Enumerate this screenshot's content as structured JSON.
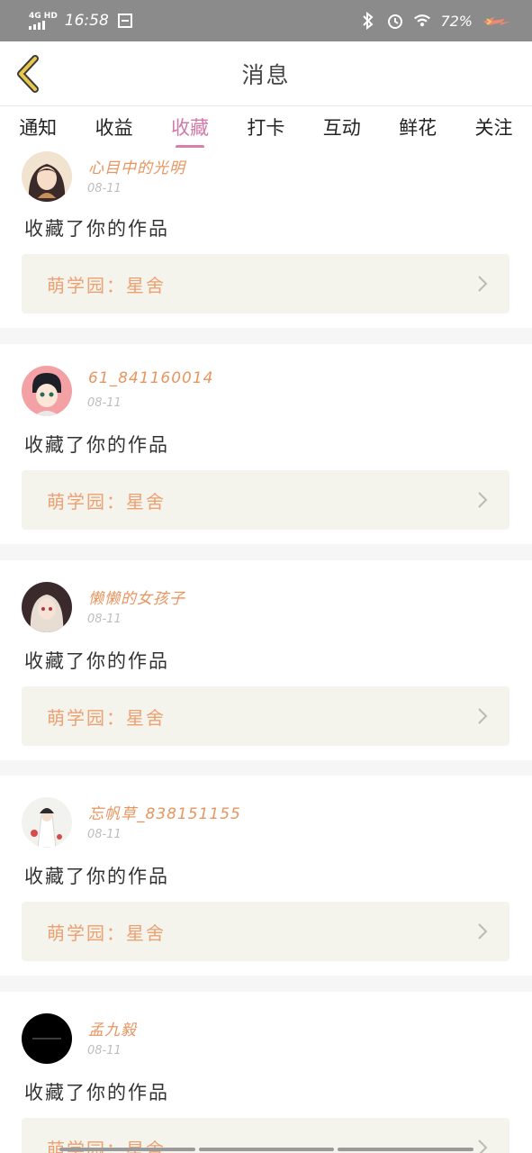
{
  "status_bar": {
    "network": "4G HD",
    "time": "16:58",
    "battery": "72%"
  },
  "header": {
    "title": "消息"
  },
  "tabs": [
    {
      "label": "通知",
      "active": false
    },
    {
      "label": "收益",
      "active": false
    },
    {
      "label": "收藏",
      "active": true
    },
    {
      "label": "打卡",
      "active": false
    },
    {
      "label": "互动",
      "active": false
    },
    {
      "label": "鲜花",
      "active": false
    },
    {
      "label": "关注",
      "active": false
    }
  ],
  "messages": [
    {
      "username": "心目中的光明",
      "date": "08-11",
      "action": "收藏了你的作品",
      "work_label": "萌学园：星舍"
    },
    {
      "username": "61_841160014",
      "date": "08-11",
      "action": "收藏了你的作品",
      "work_label": "萌学园：星舍"
    },
    {
      "username": "懒懒的女孩子",
      "date": "08-11",
      "action": "收藏了你的作品",
      "work_label": "萌学园：星舍"
    },
    {
      "username": "忘帆草_838151155",
      "date": "08-11",
      "action": "收藏了你的作品",
      "work_label": "萌学园：星舍"
    },
    {
      "username": "孟九毅",
      "date": "08-11",
      "action": "收藏了你的作品",
      "work_label": "萌学园：星舍"
    }
  ],
  "colors": {
    "accent_tab": "#d87fac",
    "username": "#e8955f",
    "work_box_bg": "#f4f3ec",
    "back_icon": "#e8c84a"
  },
  "icons": {
    "back": "chevron-left-icon",
    "chevron": "chevron-right-icon"
  }
}
